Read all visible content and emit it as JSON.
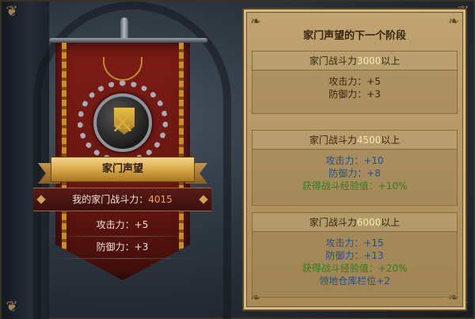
{
  "left": {
    "banner_title": "家门声望",
    "power_label": "我的家门战斗力：",
    "power_value": "4015",
    "stats": [
      "攻击力：+5",
      "防御力：+3"
    ]
  },
  "panel": {
    "title": "家门声望的下一个阶段",
    "tiers": [
      {
        "prefix": "家门战斗力",
        "threshold": "3000",
        "suffix": "以上",
        "lines": [
          "攻击力：+5",
          "防御力：+3"
        ]
      },
      {
        "prefix": "家门战斗力",
        "threshold": "4500",
        "suffix": "以上",
        "lines": [
          "攻击力：+10",
          "防御力：+8",
          "获得战斗经验值：+10%"
        ]
      },
      {
        "prefix": "家门战斗力",
        "threshold": "6000",
        "suffix": "以上",
        "lines": [
          "攻击力：+15",
          "防御力：+13",
          "获得战斗经验值：+20%",
          "领地仓库栏位+2"
        ]
      }
    ]
  },
  "colors": {
    "power_value": "#f0a64a",
    "stat_green": "#2e7d22",
    "stat_blue": "#1e4f9a",
    "panel_bg": "#bfa471"
  },
  "icons": [
    "swords-emblem-icon",
    "laurel-wreath-icon",
    "corner-ornament-icon"
  ]
}
